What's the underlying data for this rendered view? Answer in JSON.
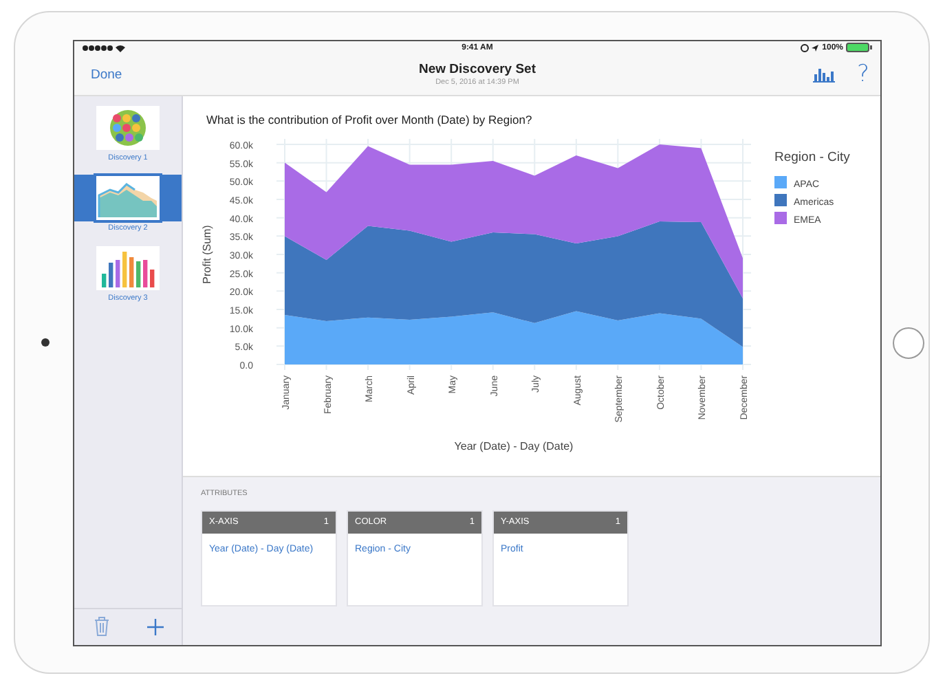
{
  "status_bar": {
    "time": "9:41 AM",
    "battery": "100%"
  },
  "nav_bar": {
    "left_button": "Done",
    "title": "New Discovery Set",
    "subtitle": "Dec 5, 2016 at 14:39 PM",
    "help": "?"
  },
  "sidebar": {
    "items": [
      {
        "label": "Discovery 1",
        "kind": "bubbles",
        "selected": false
      },
      {
        "label": "Discovery 2",
        "kind": "area",
        "selected": true
      },
      {
        "label": "Discovery 3",
        "kind": "bars",
        "selected": false
      }
    ]
  },
  "chart_panel": {
    "question": "What is the contribution of Profit over Month (Date) by Region?",
    "legend_title": "Region - City",
    "chart_data": {
      "type": "area",
      "stacked": true,
      "grid": true,
      "legend": "right",
      "xlabel": "Year (Date) - Day (Date)",
      "ylabel": "Profit (Sum)",
      "categories": [
        "January",
        "February",
        "March",
        "April",
        "May",
        "June",
        "July",
        "August",
        "September",
        "October",
        "November",
        "December"
      ],
      "series": [
        {
          "name": "APAC",
          "color": "#5aa9f8",
          "values": [
            13.5,
            11.8,
            12.8,
            12.2,
            13,
            14.2,
            11.3,
            14.5,
            12,
            14,
            12.5,
            4.8
          ]
        },
        {
          "name": "Americas",
          "color": "#3f76bd",
          "values": [
            21.5,
            16.7,
            25,
            24.3,
            20.5,
            21.8,
            24.2,
            18.5,
            23,
            25,
            26.3,
            13.2
          ]
        },
        {
          "name": "EMEA",
          "color": "#a96be6",
          "values": [
            20,
            18.5,
            21.7,
            18,
            21,
            19.5,
            16,
            24,
            18.5,
            21,
            20.2,
            11
          ]
        }
      ],
      "ylim": [
        0,
        60
      ],
      "yticks": [
        {
          "value": 0,
          "label": "0.0"
        },
        {
          "value": 5,
          "label": "5.0k"
        },
        {
          "value": 10,
          "label": "10.0k"
        },
        {
          "value": 15,
          "label": "15.0k"
        },
        {
          "value": 20,
          "label": "20.0k"
        },
        {
          "value": 25,
          "label": "25.0k"
        },
        {
          "value": 30,
          "label": "30.0k"
        },
        {
          "value": 35,
          "label": "35.0k"
        },
        {
          "value": 40,
          "label": "40.0k"
        },
        {
          "value": 45,
          "label": "45.0k"
        },
        {
          "value": 50,
          "label": "50.0k"
        },
        {
          "value": 55,
          "label": "55.0k"
        },
        {
          "value": 60,
          "label": "60.0k"
        }
      ]
    }
  },
  "attributes": {
    "heading": "ATTRIBUTES",
    "cards": [
      {
        "title": "X-AXIS",
        "count": "1",
        "value": "Year (Date) - Day (Date)"
      },
      {
        "title": "COLOR",
        "count": "1",
        "value": "Region - City"
      },
      {
        "title": "Y-AXIS",
        "count": "1",
        "value": "Profit"
      }
    ]
  }
}
